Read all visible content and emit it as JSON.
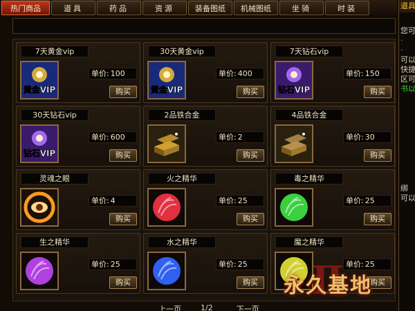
{
  "tabs": [
    {
      "label": "热门商品",
      "active": true
    },
    {
      "label": "道具",
      "active": false
    },
    {
      "label": "药品",
      "active": false
    },
    {
      "label": "资源",
      "active": false
    },
    {
      "label": "装备图纸",
      "active": false
    },
    {
      "label": "机械图纸",
      "active": false
    },
    {
      "label": "坐骑",
      "active": false
    },
    {
      "label": "时装",
      "active": false
    }
  ],
  "sidebar": {
    "title": "道具",
    "lines": [
      "您可",
      "·",
      "·",
      "可以",
      "快捷",
      "区可",
      "书以",
      "绑",
      "可以"
    ]
  },
  "items": [
    {
      "name": "7天黄金vip",
      "price_label": "单价:",
      "price": "100",
      "buy": "购买",
      "icon": "gold-vip-icon",
      "icon_text": "黄金VIP",
      "color": "#e6b83a"
    },
    {
      "name": "30天黄金vip",
      "price_label": "单价:",
      "price": "400",
      "buy": "购买",
      "icon": "gold-vip-icon",
      "icon_text": "黄金VIP",
      "color": "#e6b83a"
    },
    {
      "name": "7天钻石vip",
      "price_label": "单价:",
      "price": "150",
      "buy": "购买",
      "icon": "diamond-vip-icon",
      "icon_text": "钻石VIP",
      "color": "#b070ff"
    },
    {
      "name": "30天钻石vip",
      "price_label": "单价:",
      "price": "600",
      "buy": "购买",
      "icon": "diamond-vip-icon",
      "icon_text": "钻石VIP",
      "color": "#b070ff"
    },
    {
      "name": "2品铁合金",
      "price_label": "单价:",
      "price": "2",
      "buy": "购买",
      "icon": "gold-bars-icon",
      "icon_text": "",
      "color": "#d0a030"
    },
    {
      "name": "4品铁合金",
      "price_label": "单价:",
      "price": "30",
      "buy": "购买",
      "icon": "gold-bars-icon",
      "icon_text": "",
      "color": "#b89050"
    },
    {
      "name": "灵魂之眼",
      "price_label": "单价:",
      "price": "4",
      "buy": "购买",
      "icon": "soul-eye-icon",
      "icon_text": "",
      "color": "#ff9a20"
    },
    {
      "name": "火之精华",
      "price_label": "单价:",
      "price": "25",
      "buy": "购买",
      "icon": "fire-essence-icon",
      "icon_text": "",
      "color": "#e23040"
    },
    {
      "name": "毒之精华",
      "price_label": "单价:",
      "price": "25",
      "buy": "购买",
      "icon": "poison-essence-icon",
      "icon_text": "",
      "color": "#3ad040"
    },
    {
      "name": "生之精华",
      "price_label": "单价:",
      "price": "25",
      "buy": "购买",
      "icon": "life-essence-icon",
      "icon_text": "",
      "color": "#b040e0"
    },
    {
      "name": "水之精华",
      "price_label": "单价:",
      "price": "25",
      "buy": "购买",
      "icon": "water-essence-icon",
      "icon_text": "",
      "color": "#3060f0"
    },
    {
      "name": "魔之精华",
      "price_label": "单价:",
      "price": "25",
      "buy": "购买",
      "icon": "magic-essence-icon",
      "icon_text": "",
      "color": "#d0d030"
    }
  ],
  "pager": {
    "prev": "上一页",
    "page": "1/2",
    "next": "下一页"
  },
  "logo": {
    "text": "永久基地"
  }
}
